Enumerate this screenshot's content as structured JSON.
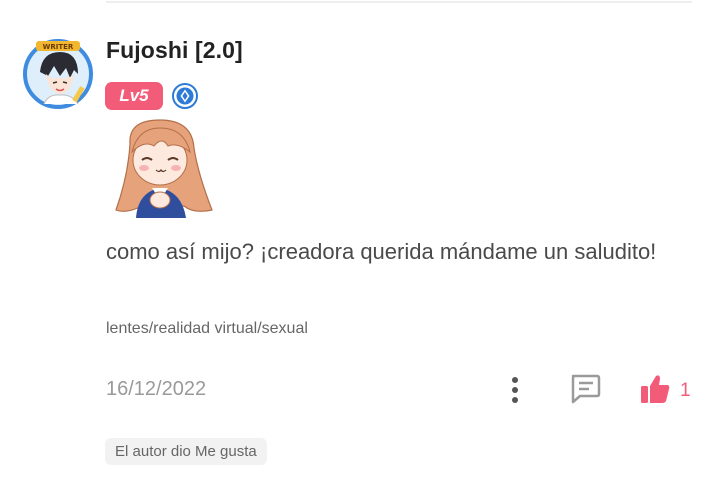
{
  "comment": {
    "username": "Fujoshi [2.0]",
    "avatar_badge_text": "WRITER",
    "level": "Lv5",
    "text": "como así mijo?    ¡creadora querida mándame un saludito!",
    "tags": "lentes/realidad virtual/sexual",
    "date": "16/12/2022",
    "likes": "1",
    "author_liked": "El autor dio Me gusta"
  },
  "colors": {
    "accent": "#f25c79",
    "title_badge": "#2e7bd6",
    "avatar_ring": "#3f8be0"
  },
  "icons": {
    "more": "more-vertical-icon",
    "reply": "comment-bubble-icon",
    "like": "thumbs-up-icon",
    "title_badge": "diamond-badge-icon"
  }
}
